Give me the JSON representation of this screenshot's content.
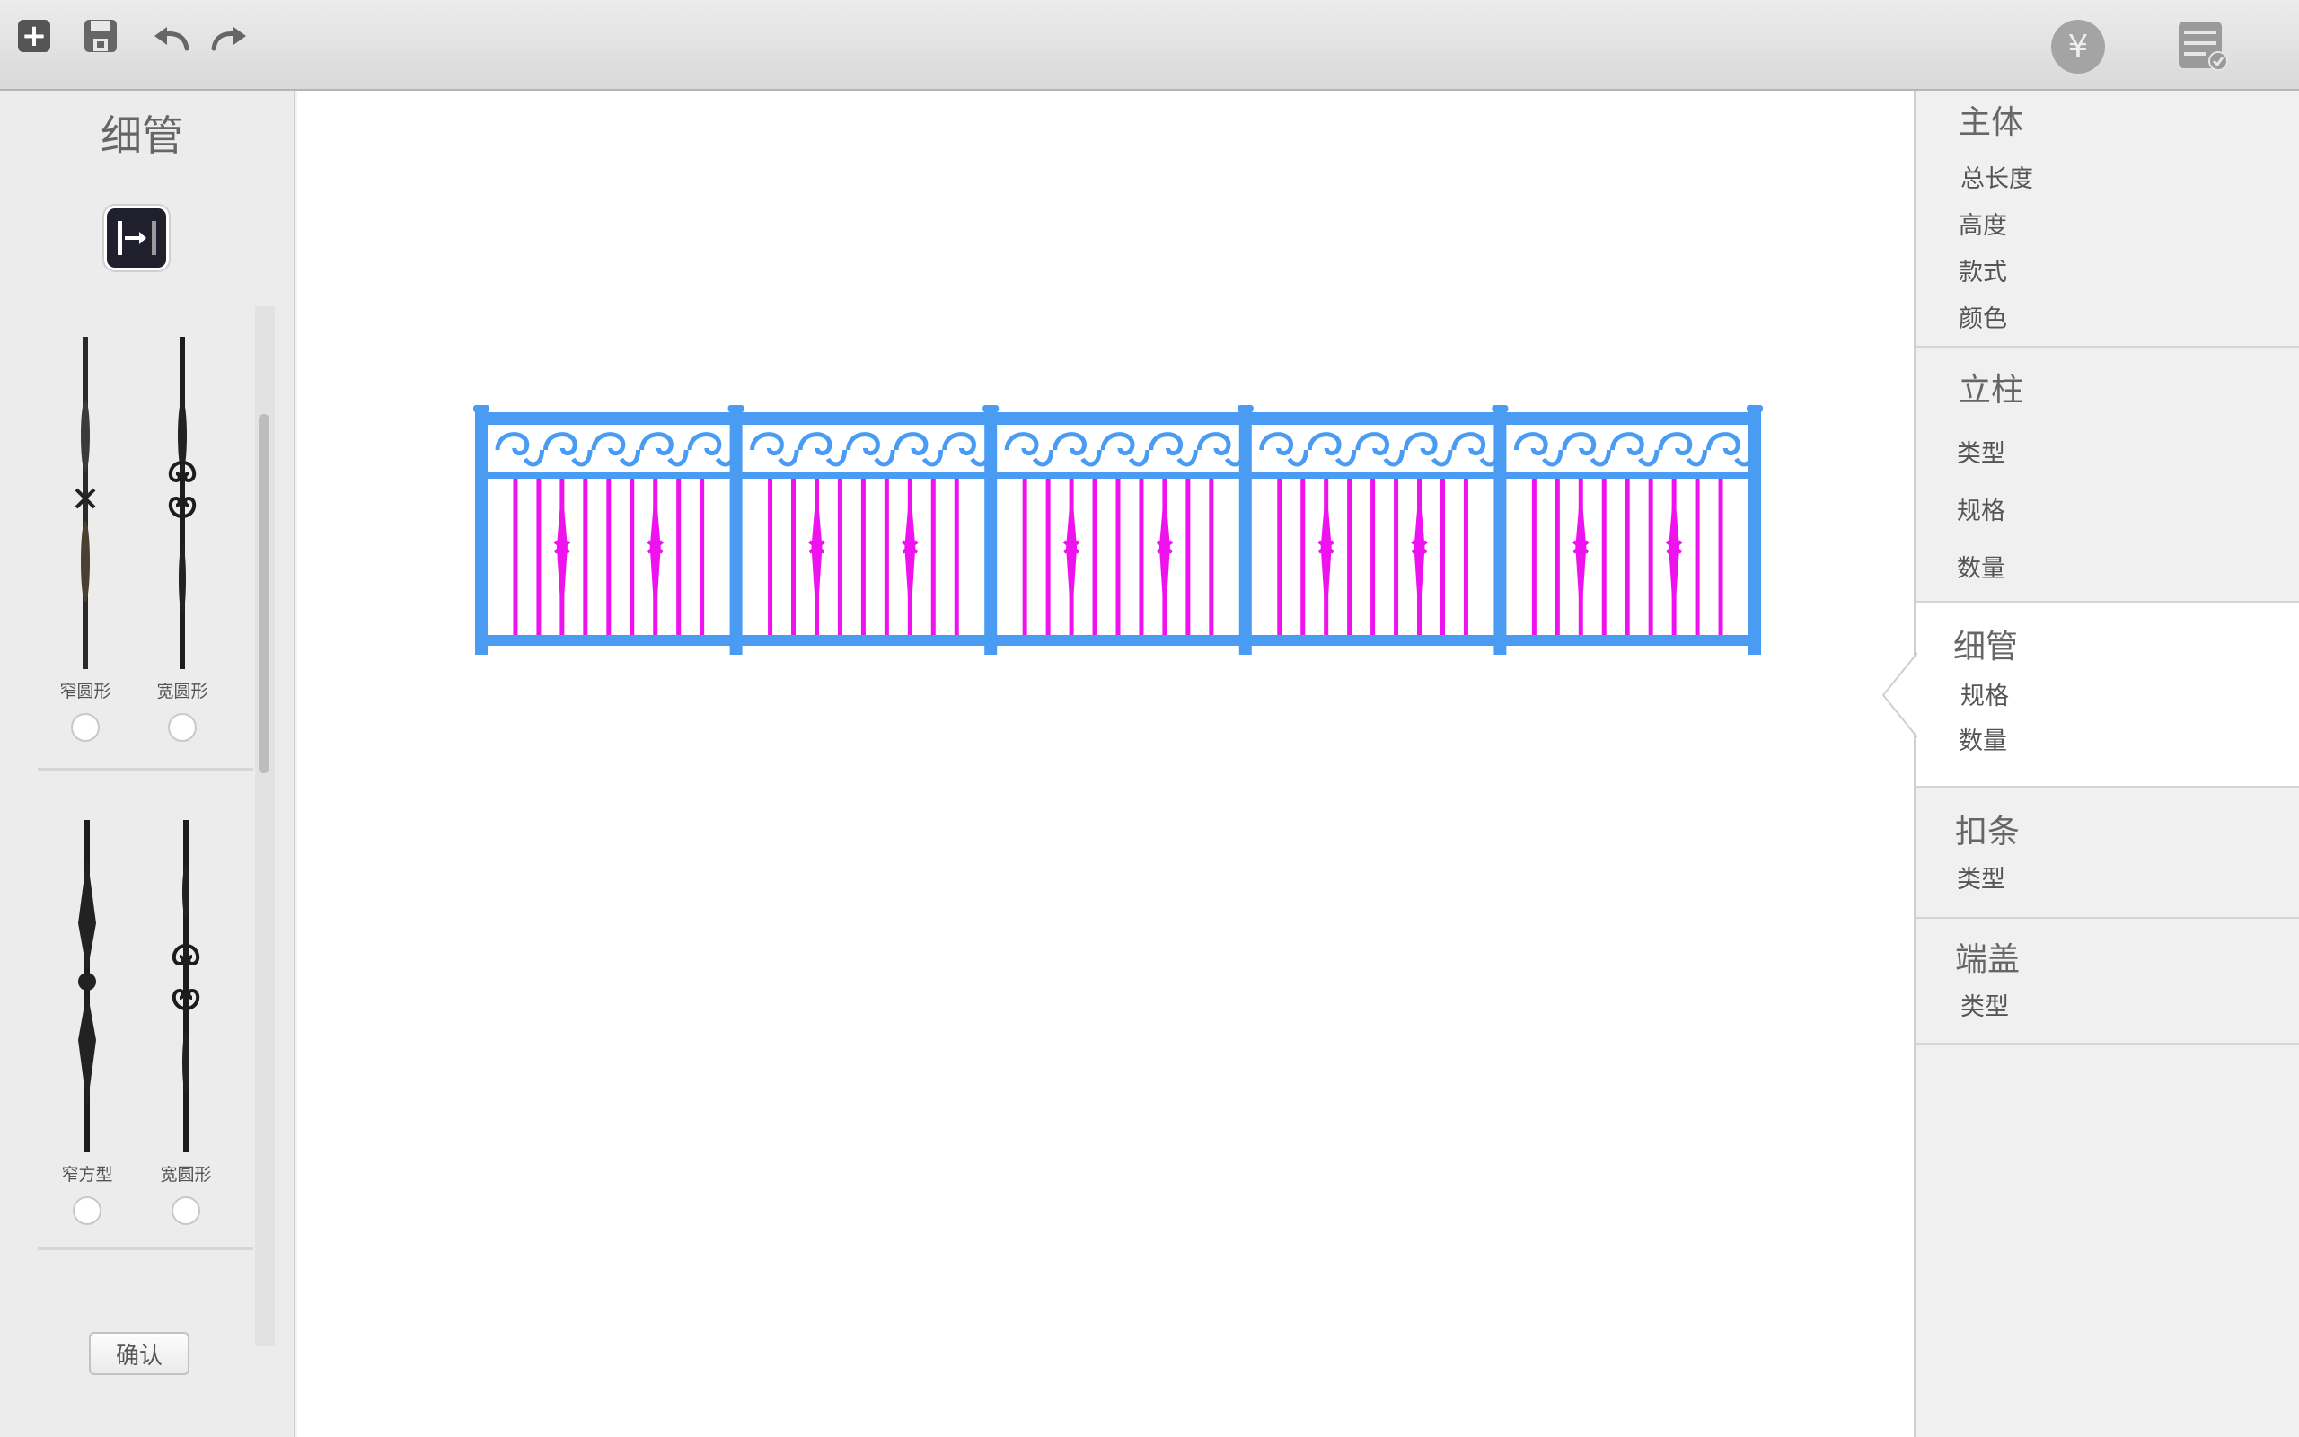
{
  "toolbar": {
    "add_icon": "plus-icon",
    "save_icon": "floppy-icon",
    "undo_icon": "undo-icon",
    "redo_icon": "redo-icon",
    "price_symbol": "¥",
    "list_icon": "list-check-icon"
  },
  "left_panel": {
    "title": "细管",
    "fit_icon": "fit-width-icon",
    "balusters": [
      {
        "label": "窄圆形",
        "selected": false
      },
      {
        "label": "宽圆形",
        "selected": false
      },
      {
        "label": "窄方型",
        "selected": false
      },
      {
        "label": "宽圆形",
        "selected": false
      }
    ],
    "confirm_label": "确认"
  },
  "canvas": {
    "panels": 5,
    "frame_color": "#4a9cf3",
    "picket_color": "#ee12ee"
  },
  "right_panel": {
    "sections": [
      {
        "title": "主体",
        "items": [
          "总长度",
          "高度",
          "款式",
          "颜色"
        ],
        "active": false
      },
      {
        "title": "立柱",
        "items": [
          "类型",
          "规格",
          "数量"
        ],
        "active": false
      },
      {
        "title": "细管",
        "items": [
          "规格",
          "数量"
        ],
        "active": true
      },
      {
        "title": "扣条",
        "items": [
          "类型"
        ],
        "active": false
      },
      {
        "title": "端盖",
        "items": [
          "类型"
        ],
        "active": false
      }
    ]
  }
}
